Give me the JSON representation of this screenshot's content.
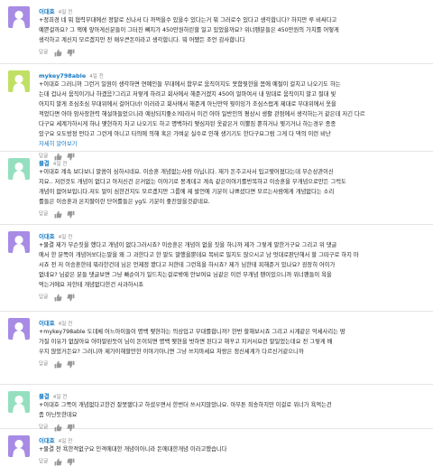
{
  "comments": [
    {
      "author": "이대호",
      "time": "4일 전",
      "avatar": "purple",
      "lines": [
        "+정희경 네 뭐 협력무대에선 정말로 신나서 다 까먹을수 있을수 있다는거 뭐 그러로수 있다고 생각합니다? 하지만 루 비싸다고",
        "예쁜걸까요? 그 잭에 앞아게신분들이 그터진 뼈지가 450만원하린할 일고 있었을까요? 위너팬분들은 450만원의 가치를 어떻게",
        "생각하고 계신지 모르겠지만 전 매우큰돈이라고 생각합니다. 뭐 어쨌든 조언 감사합니다"
      ],
      "more": "",
      "reply": "답글",
      "like_icon": "thumb-up-icon",
      "dislike_icon": "thumb-down-icon"
    },
    {
      "author": "mykey798able",
      "time": "4일 전",
      "avatar": "green",
      "lines": [
        "+이대호 그러니까 그런거 일원이 생각하면 연예인들 무대에서 함부로 움직이지도 못함뭣한을 몸에 예절이 걸치고 나오기도 하는",
        "는데 겁나서 움직이기나 하겠음?그리고 저렇게 하려고 회사에서 해준거겠지 450이 얼마여서 내 맘대로 움직이지 말고 절대 빛",
        "어지지 말게 조심조심 무대위에서 걸어다녀! 이러라고 회사에서 해준게 아닌만약 뭣이잉가 조심스럽게 제대로 무대위에서 옷을",
        "적었다면 아마 암사장현력 해설마들었으니라 예상되지좋소?따라서 이건 아마 일반인의 평상시 생활 관점에서 생각하는거 같은데 저긴 다르",
        "다구요 세계가하시게 하나 맺현하지 차고 나오기도 하고 명백하리 맺심자된 옷같은거 이뿔짐 뿐히거나 찢기거나 하는경우 종종",
        "있구요 오도방정 떤다고 그런게 아니고 타의에 의해 혹은 가벼운 실수로 인해 생기기도 한다구요그럼 그게 다 댁의 이런 비난"
      ],
      "more": "자세히 알아보기",
      "reply": "답글",
      "like_icon": "thumb-up-icon",
      "dislike_icon": "thumb-down-icon"
    },
    {
      "author": "물결",
      "time": "4일 전",
      "avatar": "mint",
      "lines": [
        "+이대호 계속 보다보니 말씀이 심하시네요. 이승훈 개념없는사람 아닙니다. 재가 돈주고사서 입고찢어졌다는데 무슨상관이신",
        "지요.. 저런것도 개념이 없다고 아저신건 은커없는 이야기로 몽계데고 계속 같은이야기를반복하고 이승훈을 무개념으로만든 그럭도",
        "개념이 없어보입니다.저도 말이 심한건지도 모르겠지만 그룹에 제 발언에 기분이 나쁘셨다면 모르는사람에게 개념없다는 소리",
        "를들은 이승훈과 온지팔이란 단어를들은 yg도 기분이 좋진않을것같네요."
      ],
      "more": "",
      "reply": "답글",
      "like_icon": "thumb-up-icon",
      "dislike_icon": "thumb-down-icon"
    },
    {
      "author": "이대호",
      "time": "4일 전",
      "avatar": "purple",
      "lines": [
        "+물결 제가 무슨짓을 했다고 개념이 없다그러시죠? 이승훈은 개념이 없을 짓을 하니까 제가 그렇게 말한거구요 그리고 위 댓글",
        "에서 한 분쪽이 개념어쏘다는말을 왜 그 과한다고 한 말도 말했을뿐데요 목비로 밀지도 않으시고 남 멋대로판단해서 할 그따구로 하지 마",
        "시죠 전 저 이승훈한테 뭐라한건데 님은 언제정 봤다고 저한테 그런욕을 하시죠? 제가 님한테 피해준거 있나요? 굉장히 어이가",
        "없네요? 님같은 분들 댓글보면 그냥 빠순이가 일드치는걸로밖에 안보여요 님같은 이런 무개념 팬이있으니까 위너팬들이 욕을",
        "먹는거에요 저한테 개념없다한건 사과하시죠"
      ],
      "more": "",
      "reply": "답글",
      "like_icon": "thumb-up-icon",
      "dislike_icon": "thumb-down-icon"
    },
    {
      "author": "이대호",
      "time": "4일 전",
      "avatar": "purple",
      "lines": [
        "+mykey798able 도데체 어느아이들이 명백 맺현하는 의상입고 무대를합니까? 한번 할해보시죠 그리고 시계같은 악세사리는 땅",
        "가질 이유가 없잖아요 아마말왼듯이 님이 돈이되면 명백 맺현을 벗하면 된다고 해꾸고 지커서요런 말일었는데요 전 그렇게 배",
        "우지 않았거든요? 그러니까 제가이해할만한 이야기아니면 그냥 쓰지마세요 처랑은 정신세계가 다르신거같으니까"
      ],
      "more": "",
      "reply": "답글",
      "like_icon": "thumb-up-icon",
      "dislike_icon": "thumb-down-icon"
    },
    {
      "author": "물결",
      "time": "4일 전",
      "avatar": "mint",
      "lines": [
        "+이대호 그쪽이 개념없다고한건 잘못됐다고 하셨우면서 한번더 쓰시지않았나요. 아무튼 죄송하지만 이걸로 위너가 욕먹는건",
        "좀 아닌듯한데요"
      ],
      "more": "",
      "reply": "답글",
      "like_icon": "thumb-up-icon",
      "dislike_icon": "thumb-down-icon"
    },
    {
      "author": "이대호",
      "time": "4일 전",
      "avatar": "purple",
      "lines": [
        "+물결 전 욕한적없구요 인격에대한 개념이아니라 돈에대한개념 이라고했습니다"
      ],
      "more": "",
      "reply": "답글",
      "like_icon": "thumb-up-icon",
      "dislike_icon": "thumb-down-icon"
    }
  ],
  "colors": {
    "purple": "#a78be5",
    "green": "#c0e065",
    "mint": "#94dfbf",
    "link": "#167ac6"
  }
}
